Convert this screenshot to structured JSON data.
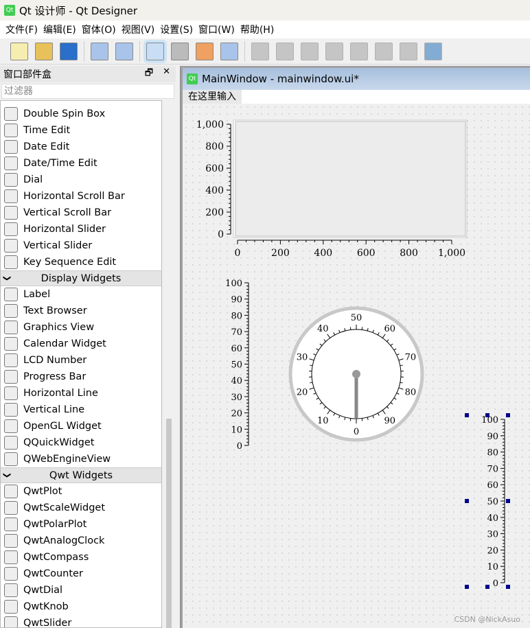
{
  "window": {
    "title": "Qt 设计师 - Qt Designer",
    "logo": "Qt"
  },
  "menu": [
    "文件(F)",
    "编辑(E)",
    "窗体(O)",
    "视图(V)",
    "设置(S)",
    "窗口(W)",
    "帮助(H)"
  ],
  "toolbar": [
    "new-icon",
    "open-icon",
    "save-icon",
    "send-to-back-icon",
    "bring-to-front-icon",
    "edit-widgets-icon",
    "edit-signals-slots-icon",
    "edit-buddies-icon",
    "edit-tab-order-icon",
    "layout-horizontal-icon",
    "layout-vertical-icon",
    "layout-horizontal-splitter-icon",
    "layout-vertical-splitter-icon",
    "layout-grid-icon",
    "layout-form-icon",
    "break-layout-icon",
    "adjust-size-icon"
  ],
  "dock": {
    "title": "窗口部件盒",
    "filter_placeholder": "过滤器",
    "items1": [
      "Double Spin Box",
      "Time Edit",
      "Date Edit",
      "Date/Time Edit",
      "Dial",
      "Horizontal Scroll Bar",
      "Vertical Scroll Bar",
      "Horizontal Slider",
      "Vertical Slider",
      "Key Sequence Edit"
    ],
    "cat1": "Display Widgets",
    "items2": [
      "Label",
      "Text Browser",
      "Graphics View",
      "Calendar Widget",
      "LCD Number",
      "Progress Bar",
      "Horizontal Line",
      "Vertical Line",
      "OpenGL Widget",
      "QQuickWidget",
      "QWebEngineView"
    ],
    "cat2": "Qwt Widgets",
    "items3": [
      "QwtPlot",
      "QwtScaleWidget",
      "QwtPolarPlot",
      "QwtAnalogClock",
      "QwtCompass",
      "QwtCounter",
      "QwtDial",
      "QwtKnob",
      "QwtSlider"
    ]
  },
  "subwindow": {
    "title": "MainWindow - mainwindow.ui*",
    "menu_placeholder": "在这里输入"
  },
  "plot": {
    "x_ticks": [
      "0",
      "200",
      "400",
      "600",
      "800",
      "1,000"
    ],
    "y_ticks": [
      "0",
      "200",
      "400",
      "600",
      "800",
      "1,000"
    ]
  },
  "scale_left": {
    "ticks": [
      "0",
      "10",
      "20",
      "30",
      "40",
      "50",
      "60",
      "70",
      "80",
      "90",
      "100"
    ]
  },
  "dial": {
    "labels": [
      "0",
      "10",
      "20",
      "30",
      "40",
      "50",
      "60",
      "70",
      "80",
      "90"
    ],
    "value": 0
  },
  "scale_right": {
    "ticks": [
      "0",
      "10",
      "20",
      "30",
      "40",
      "50",
      "60",
      "70",
      "80",
      "90",
      "100"
    ]
  },
  "watermark": "CSDN @NickAsuo"
}
